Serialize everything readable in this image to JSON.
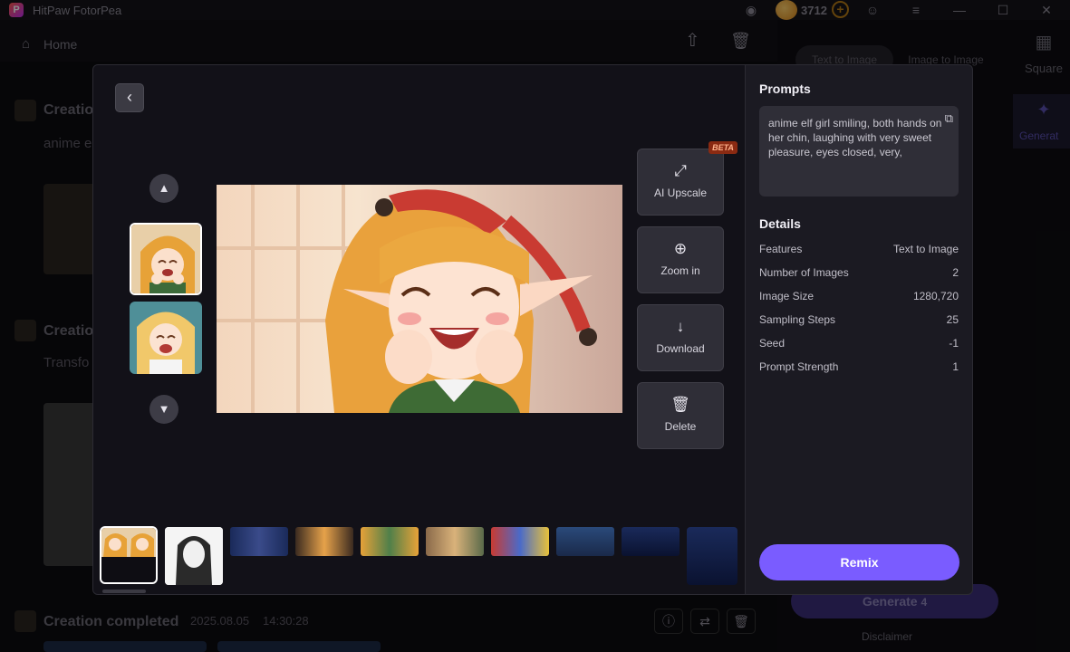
{
  "app": {
    "title": "HitPaw FotorPea",
    "logo": "P",
    "coins": "3712"
  },
  "background": {
    "home_label": "Home",
    "creation_1": {
      "title": "Creation",
      "prompt_snippet": "anime e"
    },
    "creation_2": {
      "title": "Creation",
      "prompt_snippet": "Transfo"
    },
    "creation_3": {
      "title": "Creation completed",
      "date": "2025.08.05",
      "time": "14:30:28"
    },
    "right_tabs": [
      "Text to Image",
      "Image to Image"
    ],
    "square_label": "Square",
    "generate_label": "Generat",
    "generate_button": "Generate",
    "generate_cost": "4",
    "disclaimer": "Disclaimer"
  },
  "modal": {
    "actions": [
      {
        "label": "AI Upscale",
        "icon": "expand-icon",
        "badge": "BETA"
      },
      {
        "label": "Zoom in",
        "icon": "zoom-in-icon"
      },
      {
        "label": "Download",
        "icon": "download-icon"
      },
      {
        "label": "Delete",
        "icon": "trash-icon"
      }
    ],
    "prompts_heading": "Prompts",
    "prompt_text": "anime elf girl smiling, both hands on her chin, laughing with very sweet pleasure, eyes closed, very,",
    "details_heading": "Details",
    "details": [
      {
        "key": "Features",
        "value": "Text to Image"
      },
      {
        "key": "Number of Images",
        "value": "2"
      },
      {
        "key": "Image Size",
        "value": "1280,720"
      },
      {
        "key": "Sampling Steps",
        "value": "25"
      },
      {
        "key": "Seed",
        "value": "-1"
      },
      {
        "key": "Prompt Strength",
        "value": "1"
      }
    ],
    "remix_label": "Remix"
  },
  "colors": {
    "accent": "#7a5cff",
    "beta": "#8a2a12"
  }
}
